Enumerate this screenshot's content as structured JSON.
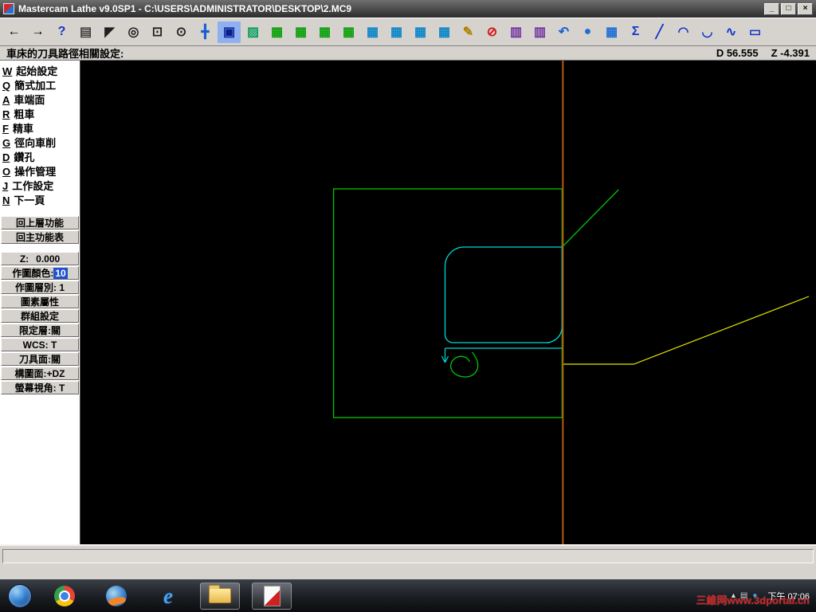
{
  "window": {
    "title": "Mastercam Lathe v9.0SP1 - C:\\USERS\\ADMINISTRATOR\\DESKTOP\\2.MC9",
    "buttons": {
      "min": "_",
      "restore": "□",
      "close": "×"
    }
  },
  "toolbar": {
    "icons": [
      {
        "name": "back-icon",
        "glyph": "←",
        "color": "#000000"
      },
      {
        "name": "forward-icon",
        "glyph": "→",
        "color": "#000000"
      },
      {
        "name": "help-icon",
        "glyph": "?",
        "color": "#1436c8"
      },
      {
        "name": "notepad-icon",
        "glyph": "▤",
        "color": "#404040"
      },
      {
        "name": "context-help-icon",
        "glyph": "◤",
        "color": "#202020"
      },
      {
        "name": "zoom-icon",
        "glyph": "◎",
        "color": "#202020"
      },
      {
        "name": "zoom-window-icon",
        "glyph": "⊡",
        "color": "#202020"
      },
      {
        "name": "unzoom-icon",
        "glyph": "⊙",
        "color": "#202020"
      },
      {
        "name": "pan-icon",
        "glyph": "╋",
        "color": "#1a5fd0"
      },
      {
        "name": "fit-screen-icon",
        "glyph": "▣",
        "color": "#0a1f8f",
        "bg": "#8fb0f0"
      },
      {
        "name": "repaint-icon",
        "glyph": "▨",
        "color": "#0a9f5f"
      },
      {
        "name": "gview-cube-top-icon",
        "glyph": "▦",
        "color": "#0ca00c"
      },
      {
        "name": "gview-cube-front-icon",
        "glyph": "▦",
        "color": "#0ca00c"
      },
      {
        "name": "gview-cube-side-icon",
        "glyph": "▦",
        "color": "#0ca00c"
      },
      {
        "name": "gview-cube-iso-icon",
        "glyph": "▦",
        "color": "#0ca00c"
      },
      {
        "name": "cplane-cube-top-icon",
        "glyph": "▦",
        "color": "#0c86c8"
      },
      {
        "name": "cplane-cube-front-icon",
        "glyph": "▦",
        "color": "#0c86c8"
      },
      {
        "name": "cplane-cube-side-icon",
        "glyph": "▦",
        "color": "#0c86c8"
      },
      {
        "name": "cplane-cube-iso-icon",
        "glyph": "▦",
        "color": "#0c86c8"
      },
      {
        "name": "pencil-icon",
        "glyph": "✎",
        "color": "#b08000"
      },
      {
        "name": "delete-icon",
        "glyph": "⊘",
        "color": "#d41414"
      },
      {
        "name": "undelete-icon",
        "glyph": "▥",
        "color": "#7030a0"
      },
      {
        "name": "undelete-all-icon",
        "glyph": "▥",
        "color": "#7030a0"
      },
      {
        "name": "undo-icon",
        "glyph": "↶",
        "color": "#1a5fd0"
      },
      {
        "name": "shading-icon",
        "glyph": "●",
        "color": "#1f6fd4"
      },
      {
        "name": "screen-menu-icon",
        "glyph": "▦",
        "color": "#1f6fd4"
      },
      {
        "name": "analyze-sigma-icon",
        "glyph": "Σ",
        "color": "#1436c8"
      },
      {
        "name": "line-icon",
        "glyph": "╱",
        "color": "#1436c8"
      },
      {
        "name": "arc-icon",
        "glyph": "◠",
        "color": "#1436c8"
      },
      {
        "name": "fillet-icon",
        "glyph": "◡",
        "color": "#1436c8"
      },
      {
        "name": "spline-icon",
        "glyph": "∿",
        "color": "#1436c8"
      },
      {
        "name": "rectangle-icon",
        "glyph": "▭",
        "color": "#1436c8"
      }
    ]
  },
  "statusline": {
    "prompt": "車床的刀具路徑相關設定:",
    "d": "D 56.555",
    "z": "Z -4.391"
  },
  "sidebar": {
    "menu_items": [
      {
        "hotkey": "W",
        "label": "起始設定"
      },
      {
        "hotkey": "Q",
        "label": "簡式加工"
      },
      {
        "hotkey": "A",
        "label": "車端面"
      },
      {
        "hotkey": "R",
        "label": "粗車"
      },
      {
        "hotkey": "F",
        "label": "精車"
      },
      {
        "hotkey": "G",
        "label": "徑向車削"
      },
      {
        "hotkey": "D",
        "label": "鑽孔"
      },
      {
        "hotkey": "O",
        "label": "操作管理"
      },
      {
        "hotkey": "J",
        "label": "工作設定"
      },
      {
        "hotkey": "N",
        "label": "下一頁"
      }
    ],
    "nav_buttons": [
      "回上層功能",
      "回主功能表"
    ],
    "z_label": "Z:",
    "z_value": "0.000",
    "color_label": "作圖顏色:",
    "color_value": "10",
    "level_label": "作圖層別:",
    "level_value": "1",
    "attr_buttons": [
      "圖素屬性",
      "群組設定",
      "限定層:關",
      "WCS:  T",
      "刀具面:關",
      "構圖面:+DZ",
      "螢幕視角: T"
    ]
  },
  "canvas": {
    "colors": {
      "stock": "#00c800",
      "profile": "#00d8d8",
      "toolpath": "#e8e800",
      "centerline": "#b45a14"
    }
  },
  "prompt_area": {
    "text": ""
  },
  "taskbar": {
    "clock": "下午 07:06",
    "watermark": "三維网www.3dportal.cn",
    "ie_glyph": "e",
    "tray_icons": [
      {
        "name": "show-hidden-icons",
        "glyph": "▴",
        "color": "#e8e8e8"
      },
      {
        "name": "network-icon",
        "glyph": "▤",
        "color": "#cfd4da"
      },
      {
        "name": "update-icon",
        "glyph": "●",
        "color": "#3fa0e8"
      }
    ]
  }
}
